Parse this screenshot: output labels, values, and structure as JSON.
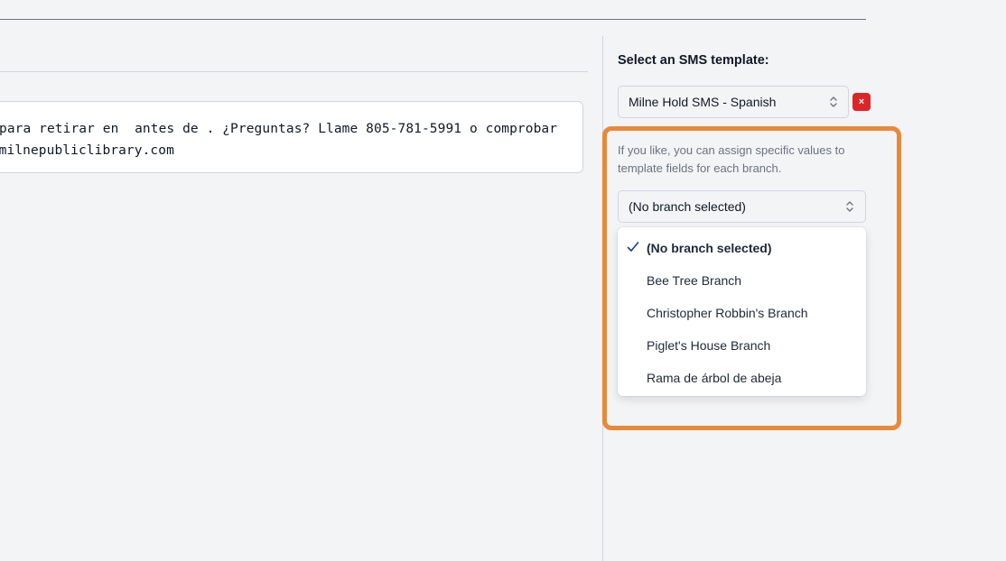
{
  "message": {
    "line1": "para retirar en  antes de . ¿Preguntas? Llame 805-781-5991 o comprobar",
    "line2": "g.milnepubliclibrary.com"
  },
  "sidebar": {
    "sms_template_label": "Select an SMS template:",
    "template_select": {
      "value": "Milne Hold SMS - Spanish",
      "icon": "chevron-up-down-icon"
    },
    "remove_button": {
      "label": "×",
      "color": "#dc2626"
    },
    "help_text": "If you like, you can assign specific values to template fields for each branch.",
    "branch_select": {
      "value": "(No branch selected)",
      "icon": "chevron-up-down-icon"
    },
    "branch_options": [
      {
        "label": "(No branch selected)",
        "selected": true
      },
      {
        "label": "Bee Tree Branch",
        "selected": false
      },
      {
        "label": "Christopher Robbin's Branch",
        "selected": false
      },
      {
        "label": "Piglet's House Branch",
        "selected": false
      },
      {
        "label": "Rama de árbol de abeja",
        "selected": false
      }
    ],
    "highlight_color": "#e8893a"
  }
}
